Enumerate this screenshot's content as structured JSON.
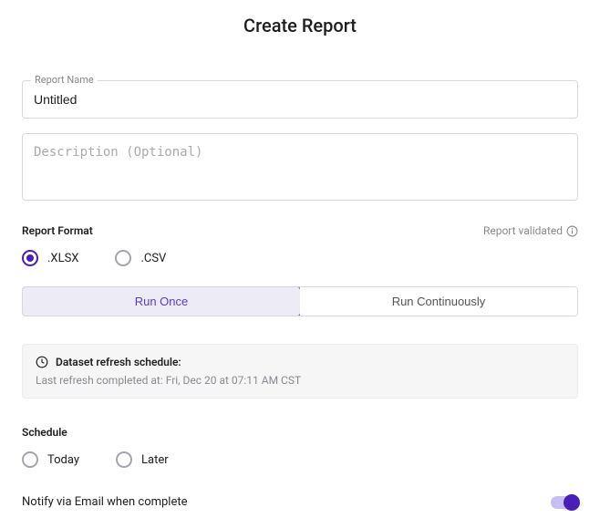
{
  "title": "Create Report",
  "reportName": {
    "label": "Report Name",
    "value": "Untitled"
  },
  "description": {
    "placeholder": "Description (Optional)",
    "value": ""
  },
  "formatSection": {
    "label": "Report Format",
    "validated": "Report validated",
    "options": [
      {
        "label": ".XLSX",
        "selected": true
      },
      {
        "label": ".CSV",
        "selected": false
      }
    ]
  },
  "runMode": {
    "options": [
      {
        "label": "Run Once",
        "active": true
      },
      {
        "label": "Run Continuously",
        "active": false
      }
    ]
  },
  "refresh": {
    "title": "Dataset refresh schedule:",
    "last": "Last refresh completed at: Fri, Dec 20 at 07:11 AM CST"
  },
  "schedule": {
    "label": "Schedule",
    "options": [
      {
        "label": "Today",
        "selected": false
      },
      {
        "label": "Later",
        "selected": false
      }
    ]
  },
  "notify": {
    "label": "Notify via Email when complete",
    "enabled": true
  }
}
